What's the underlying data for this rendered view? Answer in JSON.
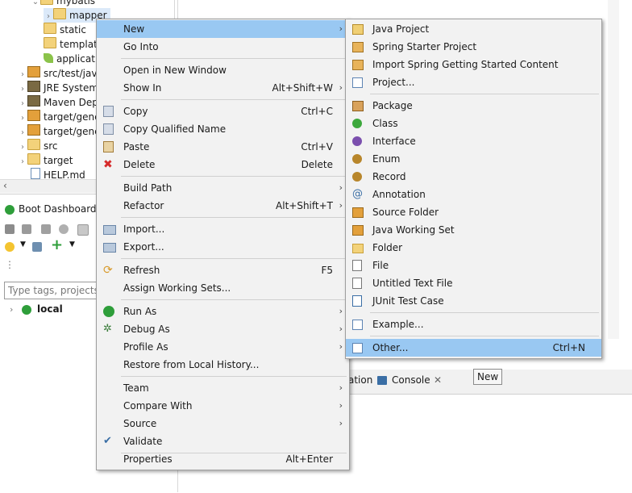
{
  "explorer": {
    "items": [
      {
        "label": "mybatis"
      },
      {
        "label": "mapper"
      },
      {
        "label": "static"
      },
      {
        "label": "templates"
      },
      {
        "label": "application"
      },
      {
        "label": "src/test/java"
      },
      {
        "label": "JRE System"
      },
      {
        "label": "Maven Dep"
      },
      {
        "label": "target/gene"
      },
      {
        "label": "target/gene"
      },
      {
        "label": "src"
      },
      {
        "label": "target"
      },
      {
        "label": "HELP.md"
      }
    ]
  },
  "boot_dashboard": {
    "title": "Boot Dashboard",
    "filter_placeholder": "Type tags, projects, o",
    "local_label": "local"
  },
  "bottom_tabs": {
    "partial_tab": "ation",
    "console_tab": "Console"
  },
  "context_menu": {
    "items": [
      {
        "label": "New",
        "submenu": true,
        "highlighted": true
      },
      {
        "label": "Go Into"
      },
      {
        "label": "Open in New Window"
      },
      {
        "label": "Show In",
        "shortcut": "Alt+Shift+W",
        "submenu": true
      },
      {
        "label": "Copy",
        "shortcut": "Ctrl+C",
        "icon": "copy-icon"
      },
      {
        "label": "Copy Qualified Name",
        "icon": "copy-qualified-icon"
      },
      {
        "label": "Paste",
        "shortcut": "Ctrl+V",
        "icon": "paste-icon"
      },
      {
        "label": "Delete",
        "shortcut": "Delete",
        "icon": "delete-icon"
      },
      {
        "label": "Build Path",
        "submenu": true
      },
      {
        "label": "Refactor",
        "shortcut": "Alt+Shift+T",
        "submenu": true
      },
      {
        "label": "Import...",
        "icon": "import-icon"
      },
      {
        "label": "Export...",
        "icon": "export-icon"
      },
      {
        "label": "Refresh",
        "shortcut": "F5",
        "icon": "refresh-icon"
      },
      {
        "label": "Assign Working Sets..."
      },
      {
        "label": "Run As",
        "submenu": true,
        "icon": "run-icon"
      },
      {
        "label": "Debug As",
        "submenu": true,
        "icon": "debug-icon"
      },
      {
        "label": "Profile As",
        "submenu": true
      },
      {
        "label": "Restore from Local History..."
      },
      {
        "label": "Team",
        "submenu": true
      },
      {
        "label": "Compare With",
        "submenu": true
      },
      {
        "label": "Source",
        "submenu": true
      },
      {
        "label": "Validate",
        "icon": "checkmark-icon"
      },
      {
        "label": "Properties",
        "shortcut": "Alt+Enter"
      }
    ]
  },
  "new_submenu": {
    "items": [
      {
        "label": "Java Project",
        "icon": "java-project-icon"
      },
      {
        "label": "Spring Starter Project",
        "icon": "spring-starter-icon"
      },
      {
        "label": "Import Spring Getting Started Content",
        "icon": "spring-import-icon"
      },
      {
        "label": "Project...",
        "icon": "project-icon"
      },
      {
        "label": "Package",
        "icon": "package-icon"
      },
      {
        "label": "Class",
        "icon": "class-icon"
      },
      {
        "label": "Interface",
        "icon": "interface-icon"
      },
      {
        "label": "Enum",
        "icon": "enum-icon"
      },
      {
        "label": "Record",
        "icon": "record-icon"
      },
      {
        "label": "Annotation",
        "icon": "annotation-icon"
      },
      {
        "label": "Source Folder",
        "icon": "source-folder-icon"
      },
      {
        "label": "Java Working Set",
        "icon": "working-set-icon"
      },
      {
        "label": "Folder",
        "icon": "folder-icon"
      },
      {
        "label": "File",
        "icon": "file-icon"
      },
      {
        "label": "Untitled Text File",
        "icon": "text-file-icon"
      },
      {
        "label": "JUnit Test Case",
        "icon": "junit-icon"
      },
      {
        "label": "Example...",
        "icon": "example-icon"
      },
      {
        "label": "Other...",
        "shortcut": "Ctrl+N",
        "icon": "other-icon",
        "highlighted": true
      }
    ]
  },
  "tooltip": {
    "text": "New"
  },
  "colors": {
    "highlight": "#99c8f2",
    "menu_bg": "#f2f2f2",
    "spring_green": "#2e9e3a"
  }
}
